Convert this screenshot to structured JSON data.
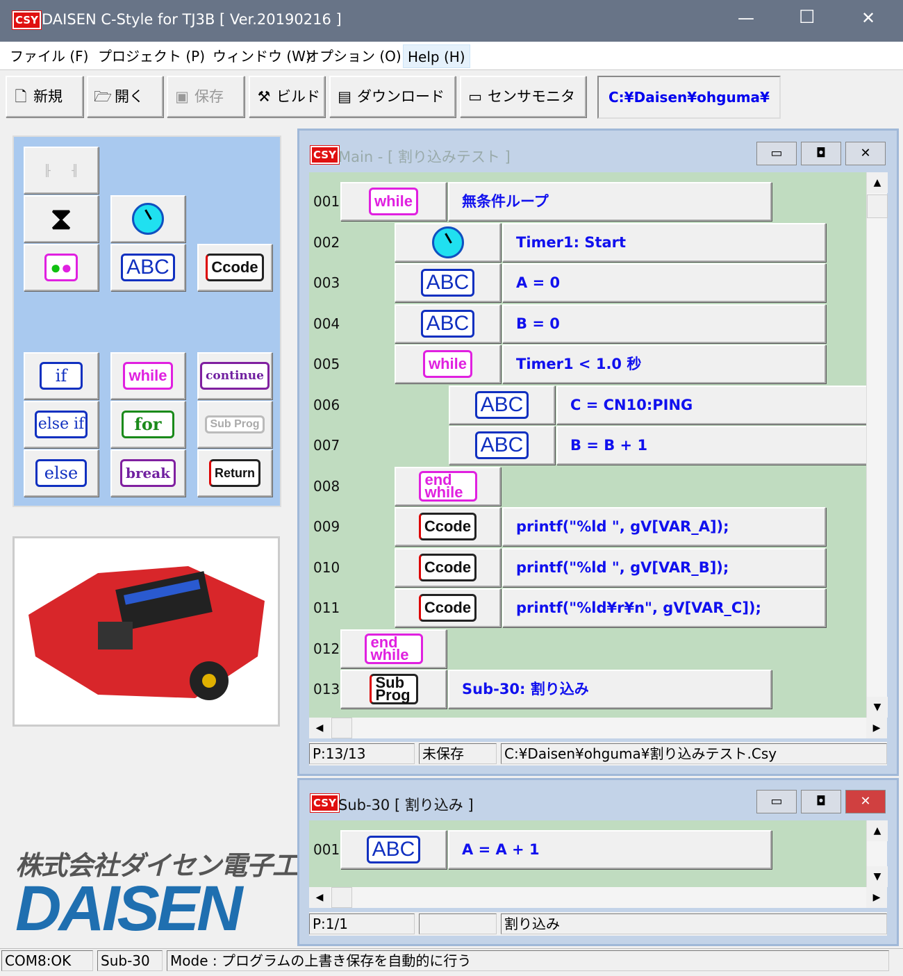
{
  "title": {
    "logo": "CSY",
    "text": "DAISEN C-Style for TJ3B  [ Ver.20190216 ]",
    "min": "—",
    "max": "☐",
    "close": "✕"
  },
  "menu": [
    "ファイル (F)",
    "プロジェクト (P)",
    "ウィンドウ (W)",
    "オプション (O)",
    "Help (H)"
  ],
  "toolbar": {
    "new": "新規",
    "open": "開く",
    "save": "保存",
    "build": "ビルド",
    "download": "ダウンロード",
    "sensor": "センサモニタ",
    "path": "C:¥Daisen¥ohguma¥"
  },
  "palette": {
    "abc": "ABC",
    "ccode": "Ccode",
    "if": "if",
    "while": "while",
    "continue": "continue",
    "elseif": "else if",
    "for": "for",
    "subprog": "Sub Prog",
    "else": "else",
    "break": "break",
    "return": "Return"
  },
  "logo": {
    "jp": "株式会社ダイセン電子工業",
    "en": "DAISEN"
  },
  "main": {
    "title": "Main - [ 割り込みテスト ]",
    "rows": [
      {
        "n": "001",
        "level": 0,
        "icon": "while",
        "text": "無条件ループ"
      },
      {
        "n": "002",
        "level": 1,
        "icon": "timer",
        "text": "Timer1: Start"
      },
      {
        "n": "003",
        "level": 1,
        "icon": "ABC",
        "text": "A = 0"
      },
      {
        "n": "004",
        "level": 1,
        "icon": "ABC",
        "text": "B = 0"
      },
      {
        "n": "005",
        "level": 1,
        "icon": "while",
        "text": "Timer1 <  1.0 秒"
      },
      {
        "n": "006",
        "level": 2,
        "icon": "ABC",
        "text": "C = CN10:PING"
      },
      {
        "n": "007",
        "level": 2,
        "icon": "ABC",
        "text": "B = B + 1"
      },
      {
        "n": "008",
        "level": 1,
        "icon": "end while",
        "text": null
      },
      {
        "n": "009",
        "level": 1,
        "icon": "Ccode",
        "text": "printf(\"%ld \", gV[VAR_A]);"
      },
      {
        "n": "010",
        "level": 1,
        "icon": "Ccode",
        "text": "printf(\"%ld \", gV[VAR_B]);"
      },
      {
        "n": "011",
        "level": 1,
        "icon": "Ccode",
        "text": "printf(\"%ld¥r¥n\", gV[VAR_C]);"
      },
      {
        "n": "012",
        "level": 0,
        "icon": "end while",
        "text": null
      },
      {
        "n": "013",
        "level": 0,
        "icon": "Sub Prog",
        "text": "Sub-30: 割り込み"
      }
    ],
    "status": {
      "page": "P:13/13",
      "saved": "未保存",
      "file": "C:¥Daisen¥ohguma¥割り込みテスト.Csy"
    }
  },
  "sub": {
    "title": "Sub-30 [ 割り込み ]",
    "rows": [
      {
        "n": "001",
        "level": 0,
        "icon": "ABC",
        "text": "A = A + 1"
      }
    ],
    "status": {
      "page": "P:1/1",
      "saved": "",
      "file": "割り込み"
    }
  },
  "statusbar": {
    "com": "COM8:OK",
    "sub": "Sub-30",
    "mode": "Mode : プログラムの上書き保存を自動的に行う"
  }
}
